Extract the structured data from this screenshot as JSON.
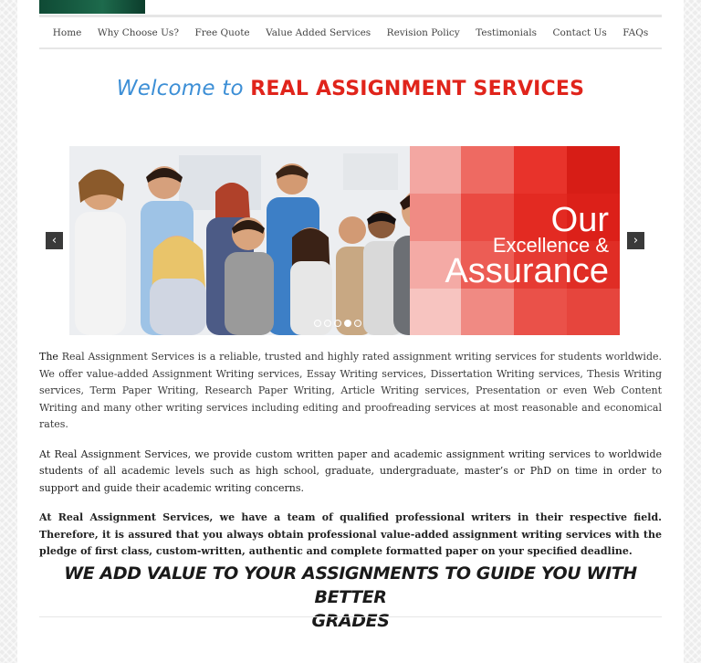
{
  "nav": {
    "items": [
      "Home",
      "Why Choose Us?",
      "Free Quote",
      "Value Added Services",
      "Revision Policy",
      "Testimonials",
      "Contact Us",
      "FAQs"
    ]
  },
  "welcome": {
    "prefix": "Welcome to",
    "brand": "REAL ASSIGNMENT SERVICES"
  },
  "slider": {
    "line1": "Our",
    "line2": "Excellence &",
    "line3": "Assurance",
    "slide_count": 5,
    "active_slide": 4,
    "prev_icon": "chevron-left-icon",
    "next_icon": "chevron-right-icon"
  },
  "content": {
    "para1_lead": "The",
    "para1_rest": " Real Assignment Services is a reliable, trusted and highly rated assignment writing services for students worldwide. We offer value-added Assignment Writing services, Essay Writing services, Dissertation Writing services, Thesis Writing services, Term Paper Writing, Research Paper Writing, Article Writing services, Presentation or even Web Content Writing and many other writing services including editing and proofreading services at most reasonable and economical rates.",
    "para2": "At Real Assignment Services, we provide custom written paper and academic assignment writing services to worldwide students of all academic levels such as high school, graduate, undergraduate, master’s or PhD on time in order to support and guide their academic writing concerns.",
    "para3": "At Real Assignment Services, we have a team of qualified professional writers in their respective field. Therefore, it is assured that you always obtain professional value-added assignment writing services with the pledge of first class, custom-written, authentic and complete formatted paper on your specified deadline."
  },
  "tagline": {
    "line1": "WE ADD VALUE TO YOUR ASSIGNMENTS TO GUIDE YOU WITH BETTER",
    "line2": "GRADES"
  },
  "colors": {
    "brand_red": "#e0241b",
    "welcome_blue": "#3d8fd6",
    "slide_red": "#e8312a"
  }
}
